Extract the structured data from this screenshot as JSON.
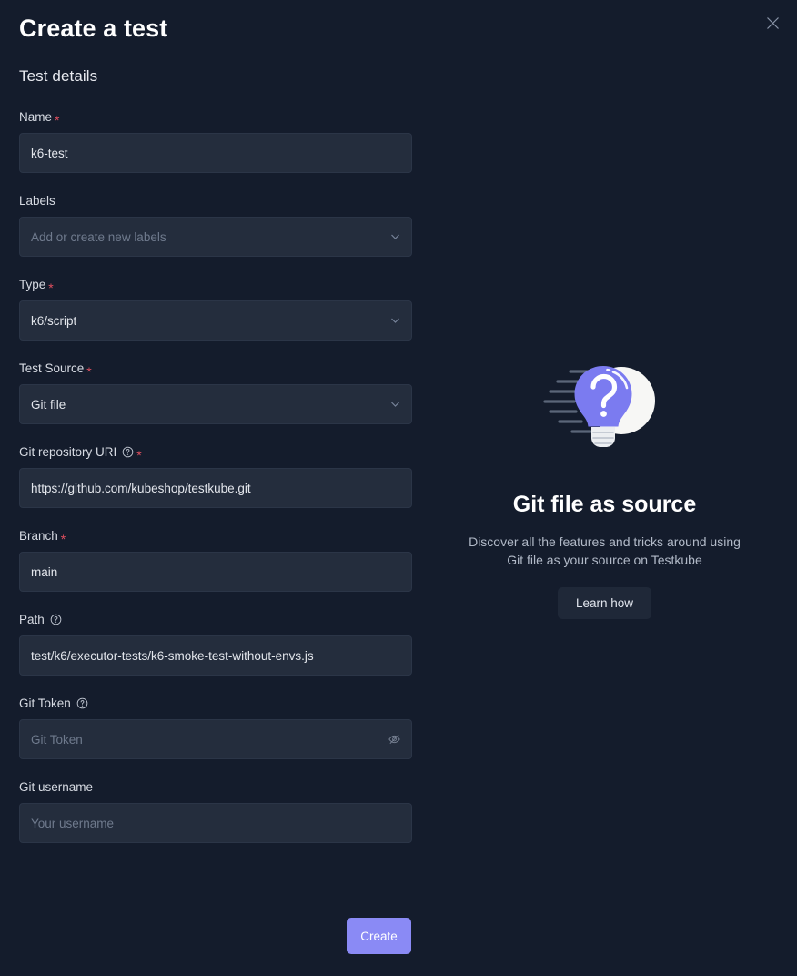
{
  "header": {
    "title": "Create a test",
    "close_icon": "close-icon"
  },
  "form": {
    "section_title": "Test details",
    "fields": [
      {
        "label": "Name",
        "required": true,
        "help": false,
        "value": "k6-test",
        "placeholder": "",
        "control": "text"
      },
      {
        "label": "Labels",
        "required": false,
        "help": false,
        "value": "",
        "placeholder": "Add or create new labels",
        "control": "select"
      },
      {
        "label": "Type",
        "required": true,
        "help": false,
        "value": "k6/script",
        "placeholder": "",
        "control": "select"
      },
      {
        "label": "Test Source",
        "required": true,
        "help": false,
        "value": "Git file",
        "placeholder": "",
        "control": "select"
      },
      {
        "label": "Git repository URI",
        "required": true,
        "help": true,
        "value": "https://github.com/kubeshop/testkube.git",
        "placeholder": "",
        "control": "text"
      },
      {
        "label": "Branch",
        "required": true,
        "help": false,
        "value": "main",
        "placeholder": "",
        "control": "text"
      },
      {
        "label": "Path",
        "required": false,
        "help": true,
        "value": "test/k6/executor-tests/k6-smoke-test-without-envs.js",
        "placeholder": "",
        "control": "text"
      },
      {
        "label": "Git Token",
        "required": false,
        "help": true,
        "value": "",
        "placeholder": "Git Token",
        "control": "password"
      },
      {
        "label": "Git username",
        "required": false,
        "help": false,
        "value": "",
        "placeholder": "Your username",
        "control": "text"
      }
    ],
    "submit_label": "Create"
  },
  "info_panel": {
    "illustration_icon": "lightbulb-question-icon",
    "title": "Git file as source",
    "description": "Discover all the features and tricks around using Git file as your source on Testkube",
    "button_label": "Learn how"
  },
  "colors": {
    "page_background": "#141c2c",
    "input_background": "#242d3d",
    "accent": "#8a8af5",
    "required_star": "#e04f5f",
    "bulb": "#7b7bf0",
    "bulb_glow": "#f7f7f5"
  }
}
